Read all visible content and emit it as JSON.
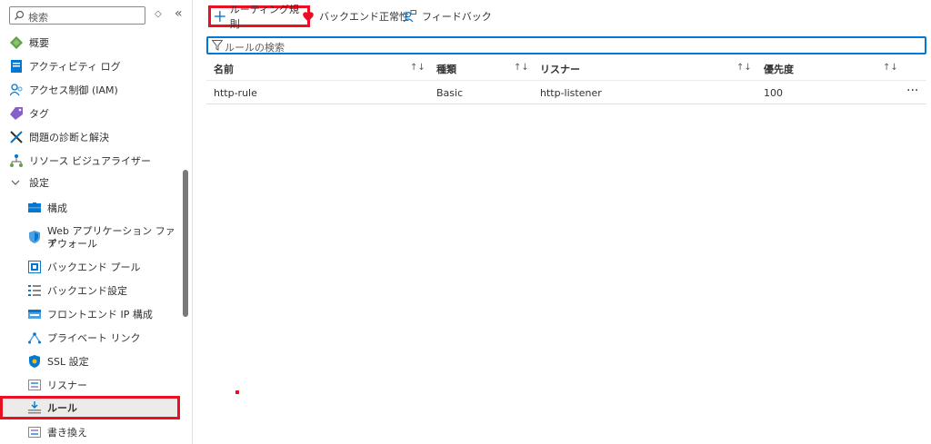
{
  "sidebar": {
    "search_placeholder": "検索",
    "items": [
      {
        "label": "概要",
        "icon": "overview-icon"
      },
      {
        "label": "アクティビティ ログ",
        "icon": "activity-log-icon"
      },
      {
        "label": "アクセス制御 (IAM)",
        "icon": "iam-icon"
      },
      {
        "label": "タグ",
        "icon": "tag-icon"
      },
      {
        "label": "問題の診断と解決",
        "icon": "diagnose-icon"
      },
      {
        "label": "リソース ビジュアライザー",
        "icon": "visualizer-icon"
      },
      {
        "label": "設定",
        "icon": "chevron-down-icon"
      },
      {
        "label": "構成",
        "icon": "configuration-icon"
      },
      {
        "label": "Web アプリケーション ファイアウォール",
        "label_line1": "Web アプリケーション ファイ",
        "label_line2": "アウォール",
        "icon": "waf-shield-icon"
      },
      {
        "label": "バックエンド プール",
        "icon": "backend-pool-icon"
      },
      {
        "label": "バックエンド設定",
        "icon": "backend-settings-icon"
      },
      {
        "label": "フロントエンド IP 構成",
        "icon": "frontend-ip-icon"
      },
      {
        "label": "プライベート リンク",
        "icon": "private-link-icon"
      },
      {
        "label": "SSL 設定",
        "icon": "ssl-shield-icon"
      },
      {
        "label": "リスナー",
        "icon": "listener-icon"
      },
      {
        "label": "ルール",
        "icon": "rules-icon"
      },
      {
        "label": "書き換え",
        "icon": "rewrite-icon"
      }
    ]
  },
  "toolbar": {
    "add_rule": "ルーティング規則",
    "backend_health": "バックエンド正常性",
    "feedback": "フィードバック"
  },
  "filter": {
    "placeholder": "ルールの検索"
  },
  "table": {
    "columns": [
      "名前",
      "種類",
      "リスナー",
      "優先度"
    ],
    "rows": [
      {
        "name": "http-rule",
        "type": "Basic",
        "listener": "http-listener",
        "priority": "100"
      }
    ]
  },
  "colors": {
    "accent": "#0078d4",
    "highlight": "#e81123"
  }
}
